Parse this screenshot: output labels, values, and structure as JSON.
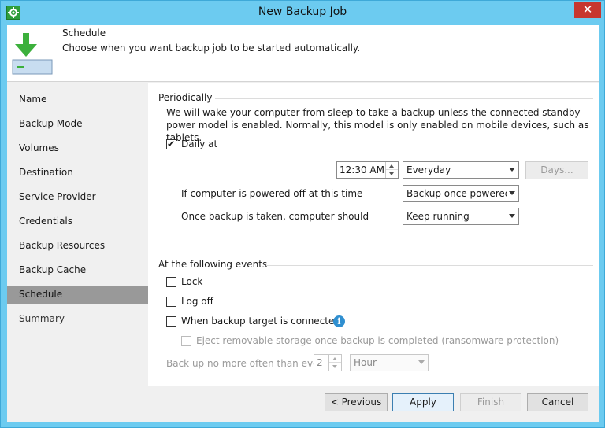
{
  "window": {
    "title": "New Backup Job",
    "close_glyph": "✕"
  },
  "header": {
    "title": "Schedule",
    "description": "Choose when you want backup job to be started automatically.",
    "icon": "download-to-drive-icon"
  },
  "nav": {
    "items": [
      {
        "label": "Name"
      },
      {
        "label": "Backup Mode"
      },
      {
        "label": "Volumes"
      },
      {
        "label": "Destination"
      },
      {
        "label": "Service Provider"
      },
      {
        "label": "Credentials"
      },
      {
        "label": "Backup Resources"
      },
      {
        "label": "Backup Cache"
      },
      {
        "label": "Schedule",
        "selected": true
      },
      {
        "label": "Summary"
      }
    ]
  },
  "periodically": {
    "section_label": "Periodically",
    "note": "We will wake your computer from sleep to take a backup unless the connected standby power model is enabled. Normally, this model is only enabled on mobile devices, such as tablets.",
    "daily": {
      "label": "Daily at",
      "checked": true,
      "time": "12:30 AM",
      "frequency": "Everyday",
      "days_button": "Days..."
    },
    "powered_off": {
      "label": "If computer is powered off at this time",
      "value": "Backup once powered on"
    },
    "after_backup": {
      "label": "Once backup is taken, computer should",
      "value": "Keep running"
    }
  },
  "events": {
    "section_label": "At the following events",
    "lock": {
      "label": "Lock",
      "checked": false
    },
    "logoff": {
      "label": "Log off",
      "checked": false
    },
    "target_connected": {
      "label": "When backup target is connected",
      "checked": false,
      "info_glyph": "i"
    },
    "eject": {
      "label": "Eject removable storage once backup is completed (ransomware protection)",
      "checked": false
    },
    "limit": {
      "label": "Back up no more often than every",
      "value": "2",
      "unit": "Hour"
    }
  },
  "buttons": {
    "previous": "< Previous",
    "apply": "Apply",
    "finish": "Finish",
    "cancel": "Cancel"
  },
  "colors": {
    "titlebar": "#6ccbf0",
    "selected_nav": "#999999",
    "close": "#c7372f",
    "accent_green": "#3cb03c"
  }
}
